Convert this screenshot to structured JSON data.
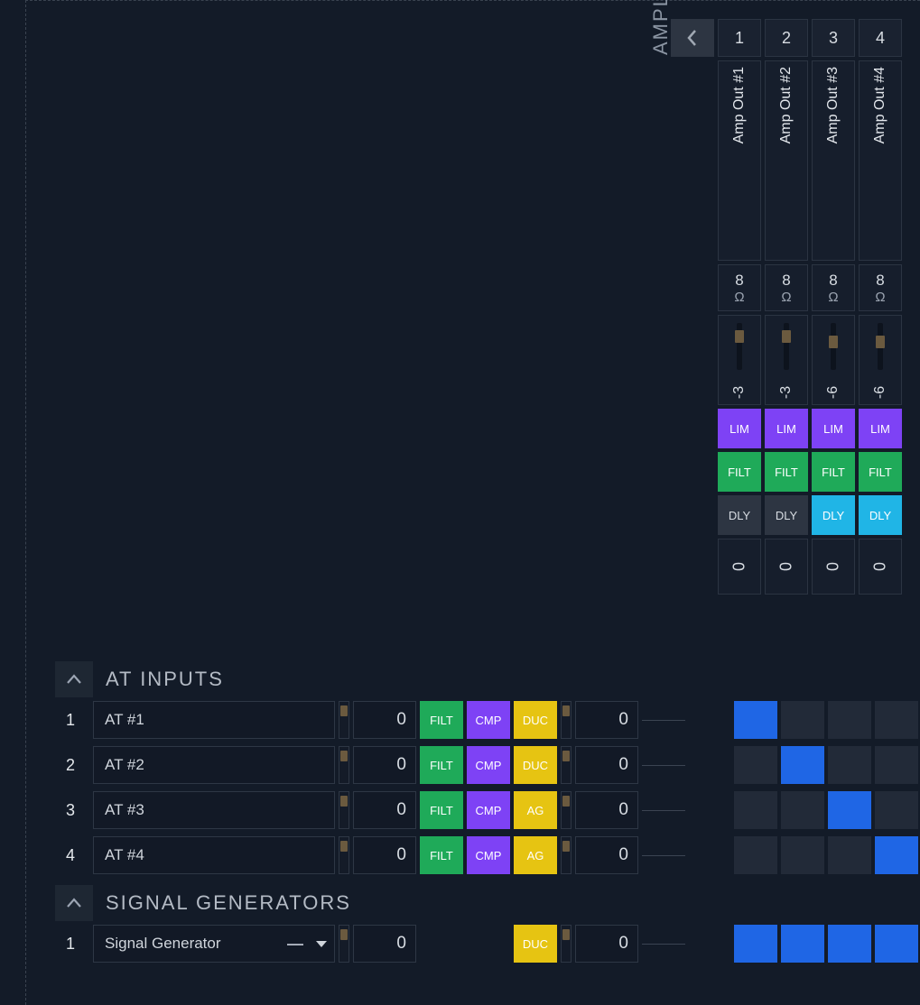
{
  "amp": {
    "section_label": "AMPLIFIER OUTPUTS",
    "numbers": [
      "1",
      "2",
      "3",
      "4"
    ],
    "names": [
      "Amp Out #1",
      "Amp Out #2",
      "Amp Out #3",
      "Amp Out #4"
    ],
    "impedance": {
      "value": "8",
      "unit": "Ω"
    },
    "fader_values": [
      "-3",
      "-3",
      "-6",
      "-6"
    ],
    "proc": {
      "lim": "LIM",
      "filt": "FILT",
      "dly": "DLY",
      "dly_on": [
        false,
        false,
        true,
        true
      ]
    },
    "zero": "0"
  },
  "sections": {
    "at_inputs": {
      "title": "AT INPUTS",
      "rows": [
        {
          "num": "1",
          "name": "AT #1",
          "val1": "0",
          "p1": "FILT",
          "p2": "CMP",
          "p3": "DUC",
          "val2": "0",
          "matrix": [
            true,
            false,
            false,
            false
          ]
        },
        {
          "num": "2",
          "name": "AT #2",
          "val1": "0",
          "p1": "FILT",
          "p2": "CMP",
          "p3": "DUC",
          "val2": "0",
          "matrix": [
            false,
            true,
            false,
            false
          ]
        },
        {
          "num": "3",
          "name": "AT #3",
          "val1": "0",
          "p1": "FILT",
          "p2": "CMP",
          "p3": "AG",
          "val2": "0",
          "matrix": [
            false,
            false,
            true,
            false
          ]
        },
        {
          "num": "4",
          "name": "AT #4",
          "val1": "0",
          "p1": "FILT",
          "p2": "CMP",
          "p3": "AG",
          "val2": "0",
          "matrix": [
            false,
            false,
            false,
            true
          ]
        }
      ]
    },
    "sig_gen": {
      "title": "SIGNAL GENERATORS",
      "rows": [
        {
          "num": "1",
          "name": "Signal Generator",
          "dash": "—",
          "val1": "0",
          "p3": "DUC",
          "val2": "0",
          "matrix": [
            true,
            true,
            true,
            true
          ]
        }
      ]
    }
  }
}
